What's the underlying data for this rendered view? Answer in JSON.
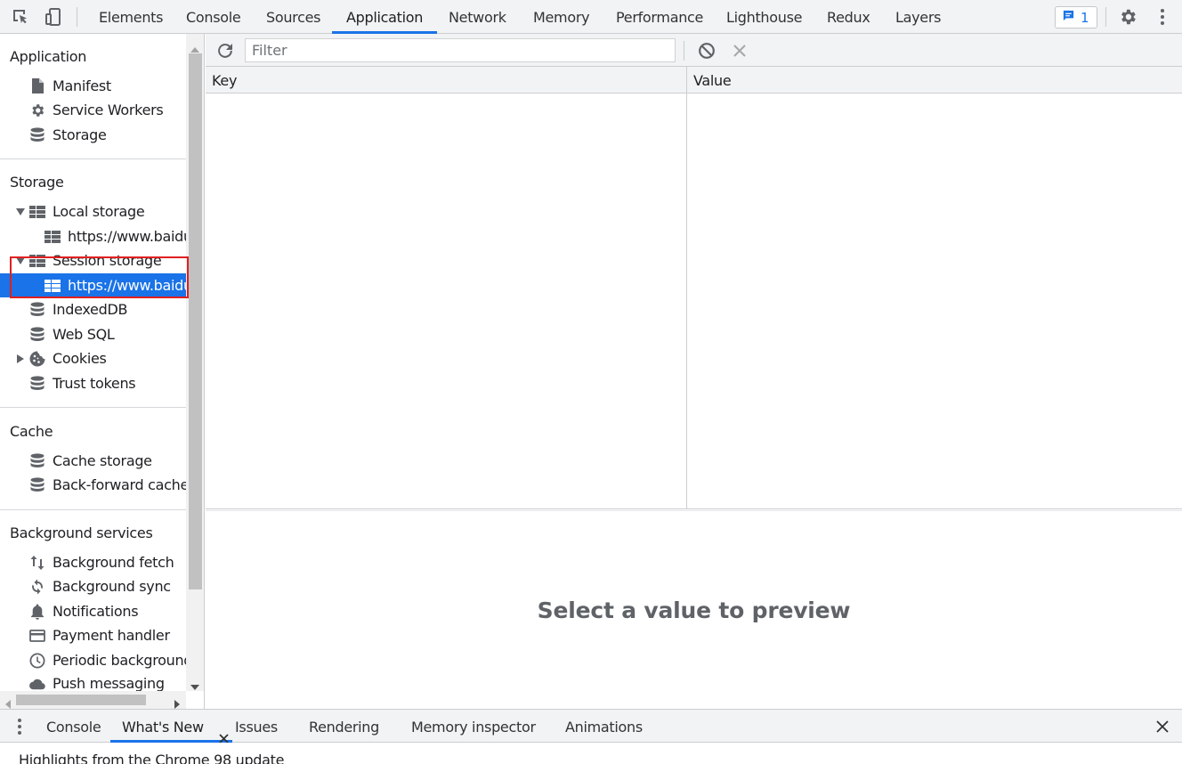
{
  "toolbar": {
    "tabs": [
      {
        "label": "Elements"
      },
      {
        "label": "Console"
      },
      {
        "label": "Sources"
      },
      {
        "label": "Application"
      },
      {
        "label": "Network"
      },
      {
        "label": "Memory"
      },
      {
        "label": "Performance"
      },
      {
        "label": "Lighthouse"
      },
      {
        "label": "Redux"
      },
      {
        "label": "Layers"
      }
    ],
    "active_tab": "Application",
    "issues_count": "1",
    "accent_color": "#1a73e8"
  },
  "sidebar": {
    "sections": {
      "application": "Application",
      "storage": "Storage",
      "cache": "Cache",
      "background": "Background services"
    },
    "items": {
      "manifest": "Manifest",
      "service_workers": "Service Workers",
      "storage": "Storage",
      "local_storage": "Local storage",
      "local_storage_origin": "https://www.baidu",
      "session_storage": "Session storage",
      "session_storage_origin": "https://www.baidu",
      "indexeddb": "IndexedDB",
      "web_sql": "Web SQL",
      "cookies": "Cookies",
      "trust_tokens": "Trust tokens",
      "cache_storage": "Cache storage",
      "back_forward_cache": "Back-forward cache",
      "background_fetch": "Background fetch",
      "background_sync": "Background sync",
      "notifications": "Notifications",
      "payment_handler": "Payment handler",
      "periodic_background": "Periodic background",
      "push_messaging": "Push messaging"
    },
    "selected_item": "session_storage_origin"
  },
  "main": {
    "filter_placeholder": "Filter",
    "columns": {
      "key": "Key",
      "value": "Value"
    },
    "rows": [],
    "preview_text": "Select a value to preview"
  },
  "drawer": {
    "tabs": [
      {
        "label": "Console"
      },
      {
        "label": "What's New"
      },
      {
        "label": "Issues"
      },
      {
        "label": "Rendering"
      },
      {
        "label": "Memory inspector"
      },
      {
        "label": "Animations"
      }
    ],
    "active_tab": "What's New",
    "content_text": "Highlights from the Chrome 98 update"
  },
  "icons": {
    "inspect": "inspect-element-icon",
    "device": "device-toolbar-icon",
    "issues": "issues-message-icon",
    "settings": "settings-gear-icon",
    "more": "more-vertical-icon",
    "refresh": "refresh-icon",
    "clear_all": "clear-all-icon",
    "delete": "delete-selected-icon",
    "drawer_menu": "drawer-menu-icon",
    "close_drawer": "close-drawer-icon"
  }
}
